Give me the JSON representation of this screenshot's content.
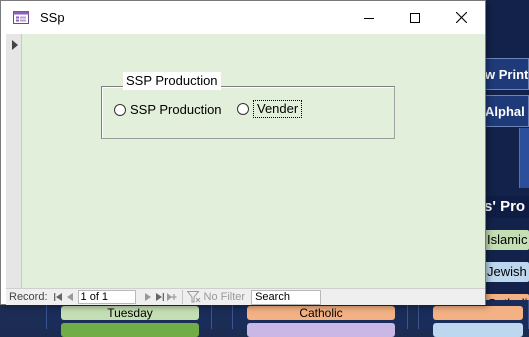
{
  "window": {
    "title": "SSp"
  },
  "frame": {
    "label": "SSP Production"
  },
  "options": [
    {
      "label": "SSP Production",
      "selected": false
    },
    {
      "label": "Vender",
      "selected": false,
      "focused": true
    }
  ],
  "navbar": {
    "record_label": "Record:",
    "record_value": "1 of 1",
    "filter_label": "No Filter",
    "search_placeholder": "Search"
  },
  "background": {
    "buttons": [
      "w Print",
      "Alphal"
    ],
    "section_header": "s' Pro",
    "chips": [
      "Islamic",
      "Jewish",
      "Catholic"
    ],
    "bottom_pills": [
      "Tuesday",
      "Catholic"
    ]
  },
  "colors": {
    "form_bg": "#e2efda",
    "bg_navy": "#1c2d55",
    "chip_green": "#c5dfb4",
    "chip_blue": "#bdd7ee",
    "chip_orange": "#f4b183"
  }
}
